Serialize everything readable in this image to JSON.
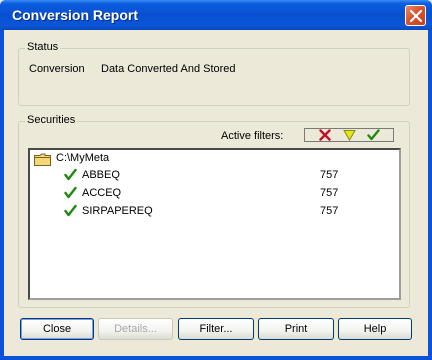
{
  "window": {
    "title": "Conversion Report"
  },
  "status": {
    "legend": "Status",
    "label": "Conversion",
    "value": "Data Converted And Stored"
  },
  "securities": {
    "legend": "Securities",
    "filters_label": "Active filters:",
    "filters": [
      {
        "icon": "red-x-icon"
      },
      {
        "icon": "yellow-triangle-icon"
      },
      {
        "icon": "green-check-icon"
      }
    ],
    "root": "C:\\MyMeta",
    "rows": [
      {
        "name": "ABBEQ",
        "count": "757"
      },
      {
        "name": "ACCEQ",
        "count": "757"
      },
      {
        "name": "SIRPAPEREQ",
        "count": "757"
      }
    ]
  },
  "buttons": {
    "close": "Close",
    "details": "Details...",
    "filter": "Filter...",
    "print": "Print",
    "help": "Help"
  },
  "colors": {
    "titlebar": "#0a56d8",
    "close_button": "#d8542f",
    "check": "#1f8a12",
    "x": "#c0102c",
    "triangle": "#e4e61a"
  }
}
